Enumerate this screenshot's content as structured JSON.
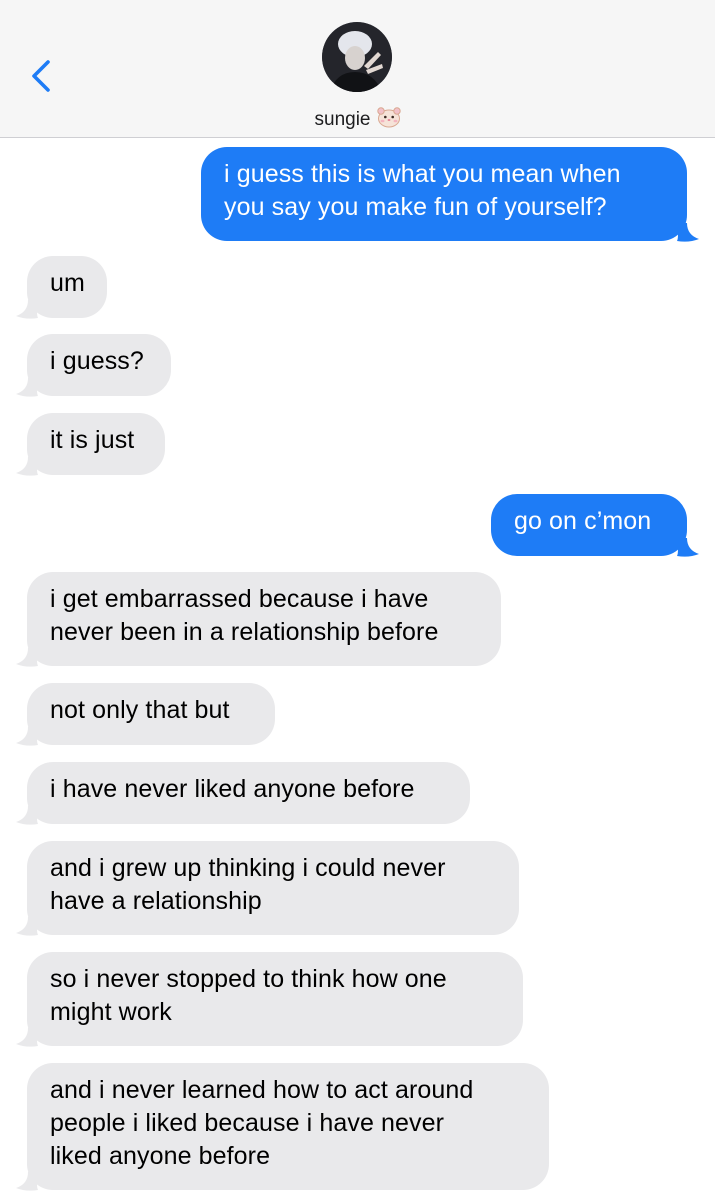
{
  "header": {
    "back_icon": "chevron-left-icon",
    "contact_name": "sungie",
    "contact_emoji": "hamster-face-icon",
    "accent_color": "#1e7cf6"
  },
  "messages": [
    {
      "sender": "me",
      "lines": [
        "i guess this is what you mean when",
        "you say you make fun of yourself?"
      ]
    },
    {
      "sender": "them",
      "lines": [
        "um"
      ]
    },
    {
      "sender": "them",
      "lines": [
        "i guess?"
      ]
    },
    {
      "sender": "them",
      "lines": [
        "it is just"
      ]
    },
    {
      "sender": "me",
      "lines": [
        "go on c’mon"
      ]
    },
    {
      "sender": "them",
      "lines": [
        "i get embarrassed because i have",
        "never been in a relationship before"
      ]
    },
    {
      "sender": "them",
      "lines": [
        "not only that but"
      ]
    },
    {
      "sender": "them",
      "lines": [
        "i have never liked anyone before"
      ]
    },
    {
      "sender": "them",
      "lines": [
        "and i grew up thinking i could never",
        "have a relationship"
      ]
    },
    {
      "sender": "them",
      "lines": [
        "so i never stopped to think how one",
        "might work"
      ]
    },
    {
      "sender": "them",
      "lines": [
        "and i never learned how to act around",
        "people i liked because i have never",
        "liked anyone before"
      ]
    }
  ]
}
